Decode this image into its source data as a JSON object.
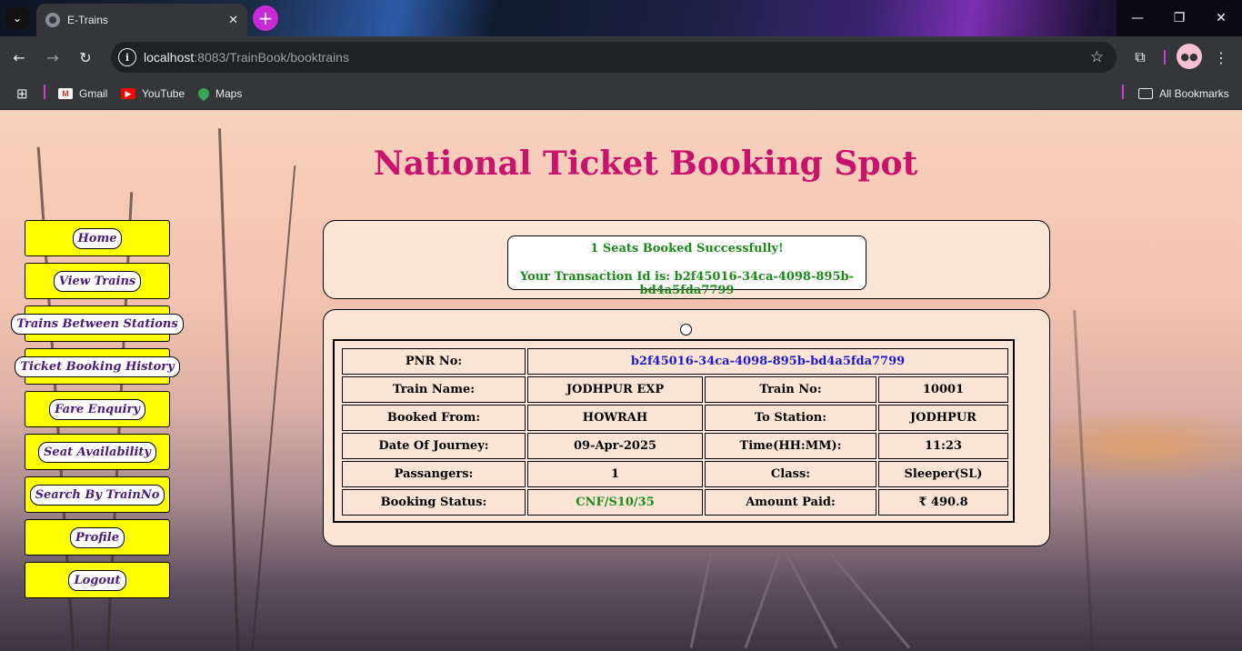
{
  "browser": {
    "tab_title": "E-Trains",
    "url_host": "localhost",
    "url_path": ":8083/TrainBook/booktrains",
    "bookmarks": [
      {
        "label": "Gmail",
        "icon": "gmail-icon"
      },
      {
        "label": "YouTube",
        "icon": "youtube-icon"
      },
      {
        "label": "Maps",
        "icon": "maps-icon"
      }
    ],
    "all_bookmarks": "All Bookmarks"
  },
  "page": {
    "title": "National Ticket Booking Spot",
    "menu": [
      "Home",
      "View Trains",
      "Trains Between Stations",
      "Ticket Booking History",
      "Fare Enquiry",
      "Seat Availability",
      "Search By TrainNo",
      "Profile",
      "Logout"
    ],
    "message": {
      "line1": "1 Seats Booked Successfully!",
      "line2": "Your Transaction Id is: b2f45016-34ca-4098-895b-bd4a5fda7799"
    },
    "ticket": {
      "pnr_label": "PNR No:",
      "pnr_value": "b2f45016-34ca-4098-895b-bd4a5fda7799",
      "train_name_label": "Train Name:",
      "train_name_value": "JODHPUR EXP",
      "train_no_label": "Train No:",
      "train_no_value": "10001",
      "from_label": "Booked From:",
      "from_value": "HOWRAH",
      "to_label": "To Station:",
      "to_value": "JODHPUR",
      "doj_label": "Date Of Journey:",
      "doj_value": "09-Apr-2025",
      "time_label": "Time(HH:MM):",
      "time_value": "11:23",
      "passengers_label": "Passangers:",
      "passengers_value": "1",
      "class_label": "Class:",
      "class_value": "Sleeper(SL)",
      "status_label": "Booking Status:",
      "status_value": "CNF/S10/35",
      "amount_label": "Amount Paid:",
      "amount_value": "₹ 490.8"
    }
  },
  "colors": {
    "heading": "#c8126e",
    "menu_bg": "#ffff00",
    "success": "#1a8a1a",
    "pnr": "#1a1ad1",
    "panel": "#fde5d6"
  }
}
